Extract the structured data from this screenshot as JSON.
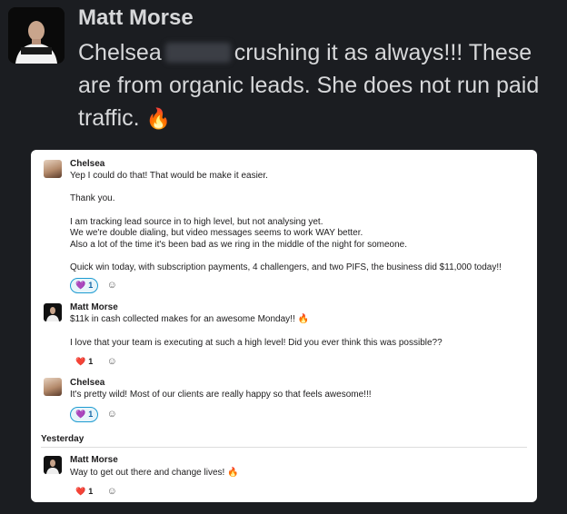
{
  "post": {
    "author": "Matt Morse",
    "text_before": "Chelsea",
    "text_after": "crushing it as always!!! These are from organic leads. She does not run paid traffic.",
    "emoji": "🔥"
  },
  "thread": {
    "messages": [
      {
        "author": "Chelsea",
        "lines": [
          "Yep I could do that! That would be make it easier.",
          "Thank you.",
          "I am tracking lead source in to high level, but not analysing yet.",
          "We we're double dialing, but video messages seems to work WAY better.",
          "Also a lot of the time it's been bad as we ring in the middle of the night for someone.",
          "Quick win today, with subscription payments, 4 challengers, and two PIFS, the business did $11,000 today!!"
        ],
        "reaction": {
          "emoji": "💜",
          "count": "1"
        }
      },
      {
        "author": "Matt Morse",
        "lines": [
          "$11k in cash collected makes for an awesome Monday!! 🔥",
          "I love that your team is executing at such a high level! Did you ever think this was possible??"
        ],
        "reaction": {
          "emoji": "❤️",
          "count": "1"
        }
      },
      {
        "author": "Chelsea",
        "lines": [
          "It's pretty wild! Most of our clients are really happy so that feels awesome!!!"
        ],
        "reaction": {
          "emoji": "💜",
          "count": "1"
        }
      },
      {
        "author": "Matt Morse",
        "lines": [
          "Way to get out there and change lives! 🔥"
        ],
        "reaction": {
          "emoji": "❤️",
          "count": "1"
        }
      }
    ],
    "divider": "Yesterday",
    "add_reaction_icon": "☺"
  }
}
